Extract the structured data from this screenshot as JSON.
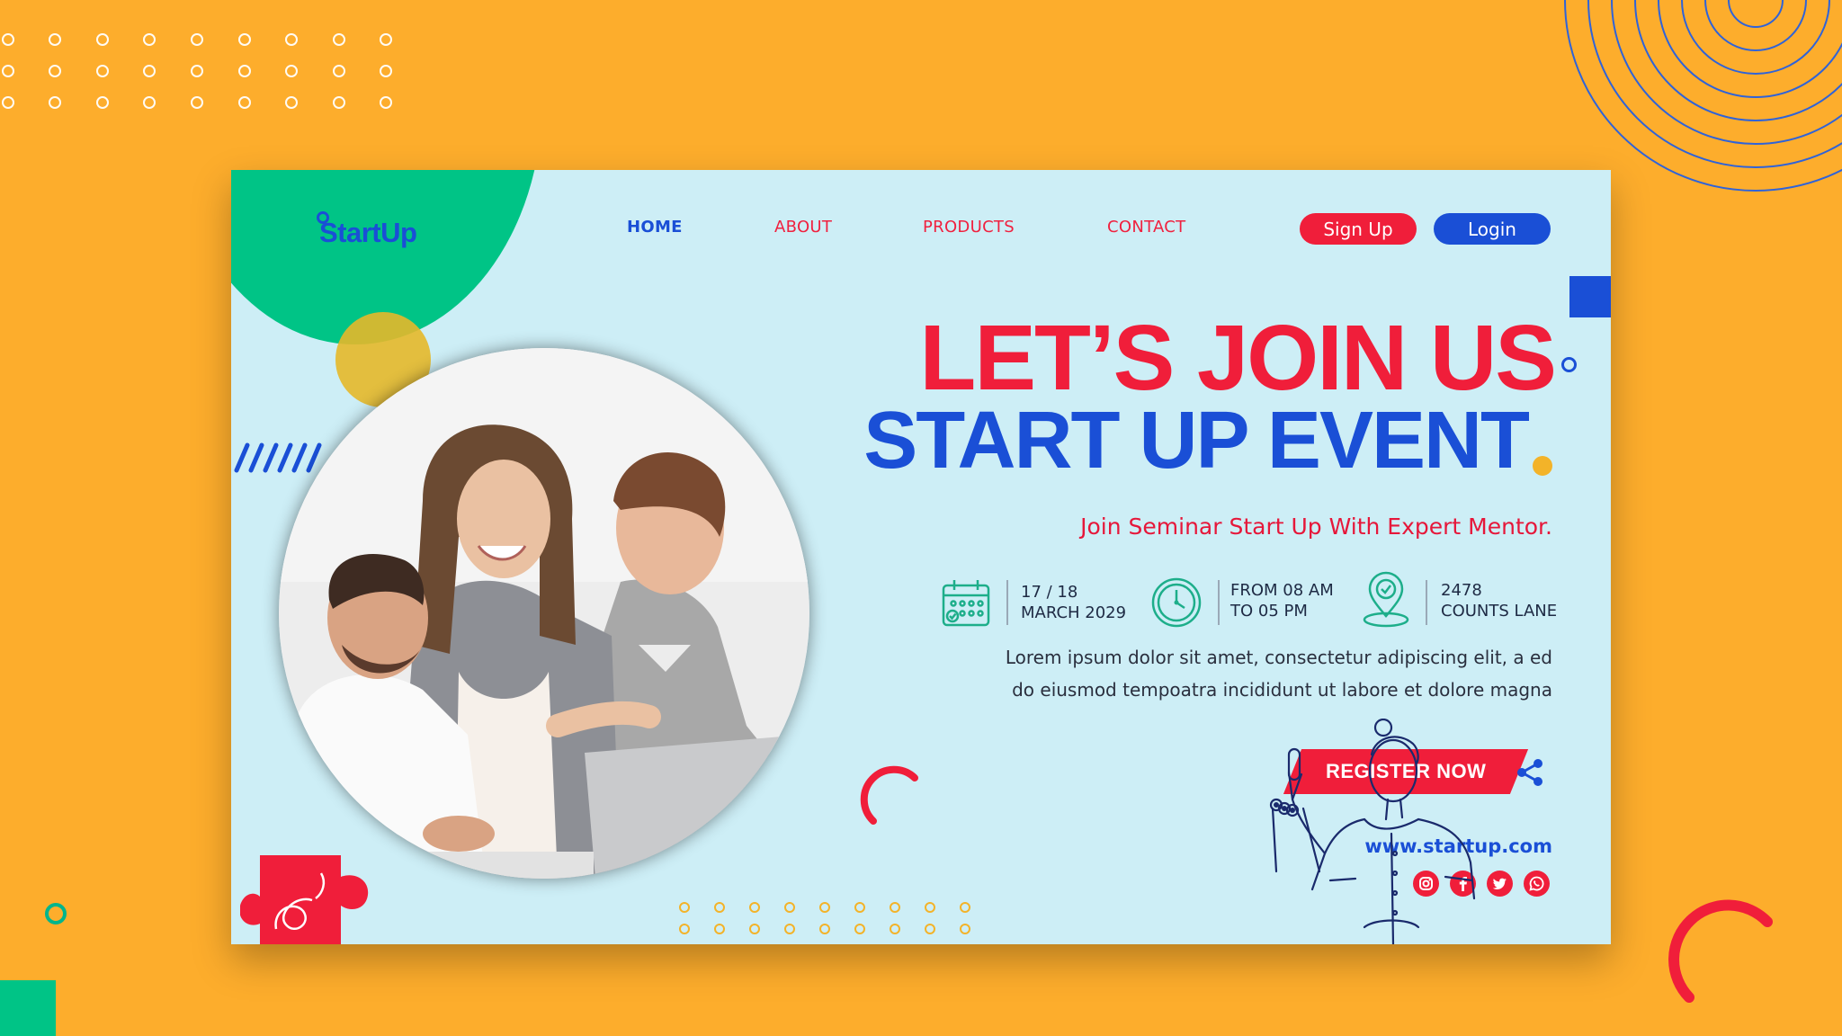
{
  "brand": {
    "logo_text": "StartUp"
  },
  "nav": {
    "items": [
      {
        "label": "HOME",
        "active": true
      },
      {
        "label": "ABOUT",
        "active": false
      },
      {
        "label": "PRODUCTS",
        "active": false
      },
      {
        "label": "CONTACT",
        "active": false
      }
    ]
  },
  "auth": {
    "signup_label": "Sign Up",
    "login_label": "Login"
  },
  "hero": {
    "line1": "LET’S JOIN US",
    "line2": "START UP EVENT",
    "subtitle": "Join Seminar Start Up With Expert Mentor."
  },
  "event_info": {
    "date_line1": "17 / 18",
    "date_line2": "MARCH 2029",
    "time_line1": "FROM 08 AM",
    "time_line2": "TO 05 PM",
    "place_line1": "2478",
    "place_line2": "COUNTS LANE"
  },
  "description": {
    "line1": "Lorem ipsum dolor sit amet, consectetur adipiscing elit, a ed",
    "line2": "do eiusmod tempoatra incididunt ut labore et dolore magna"
  },
  "cta": {
    "register_label": "REGISTER NOW"
  },
  "footer": {
    "website": "www.startup.com",
    "social_icons": [
      "instagram-icon",
      "facebook-icon",
      "twitter-icon",
      "whatsapp-icon"
    ]
  },
  "colors": {
    "background": "#FDAD2C",
    "card": "#CDEEF6",
    "red": "#F01E3A",
    "blue": "#1A4FD6",
    "green": "#00C486",
    "yellow": "#F3B329"
  }
}
